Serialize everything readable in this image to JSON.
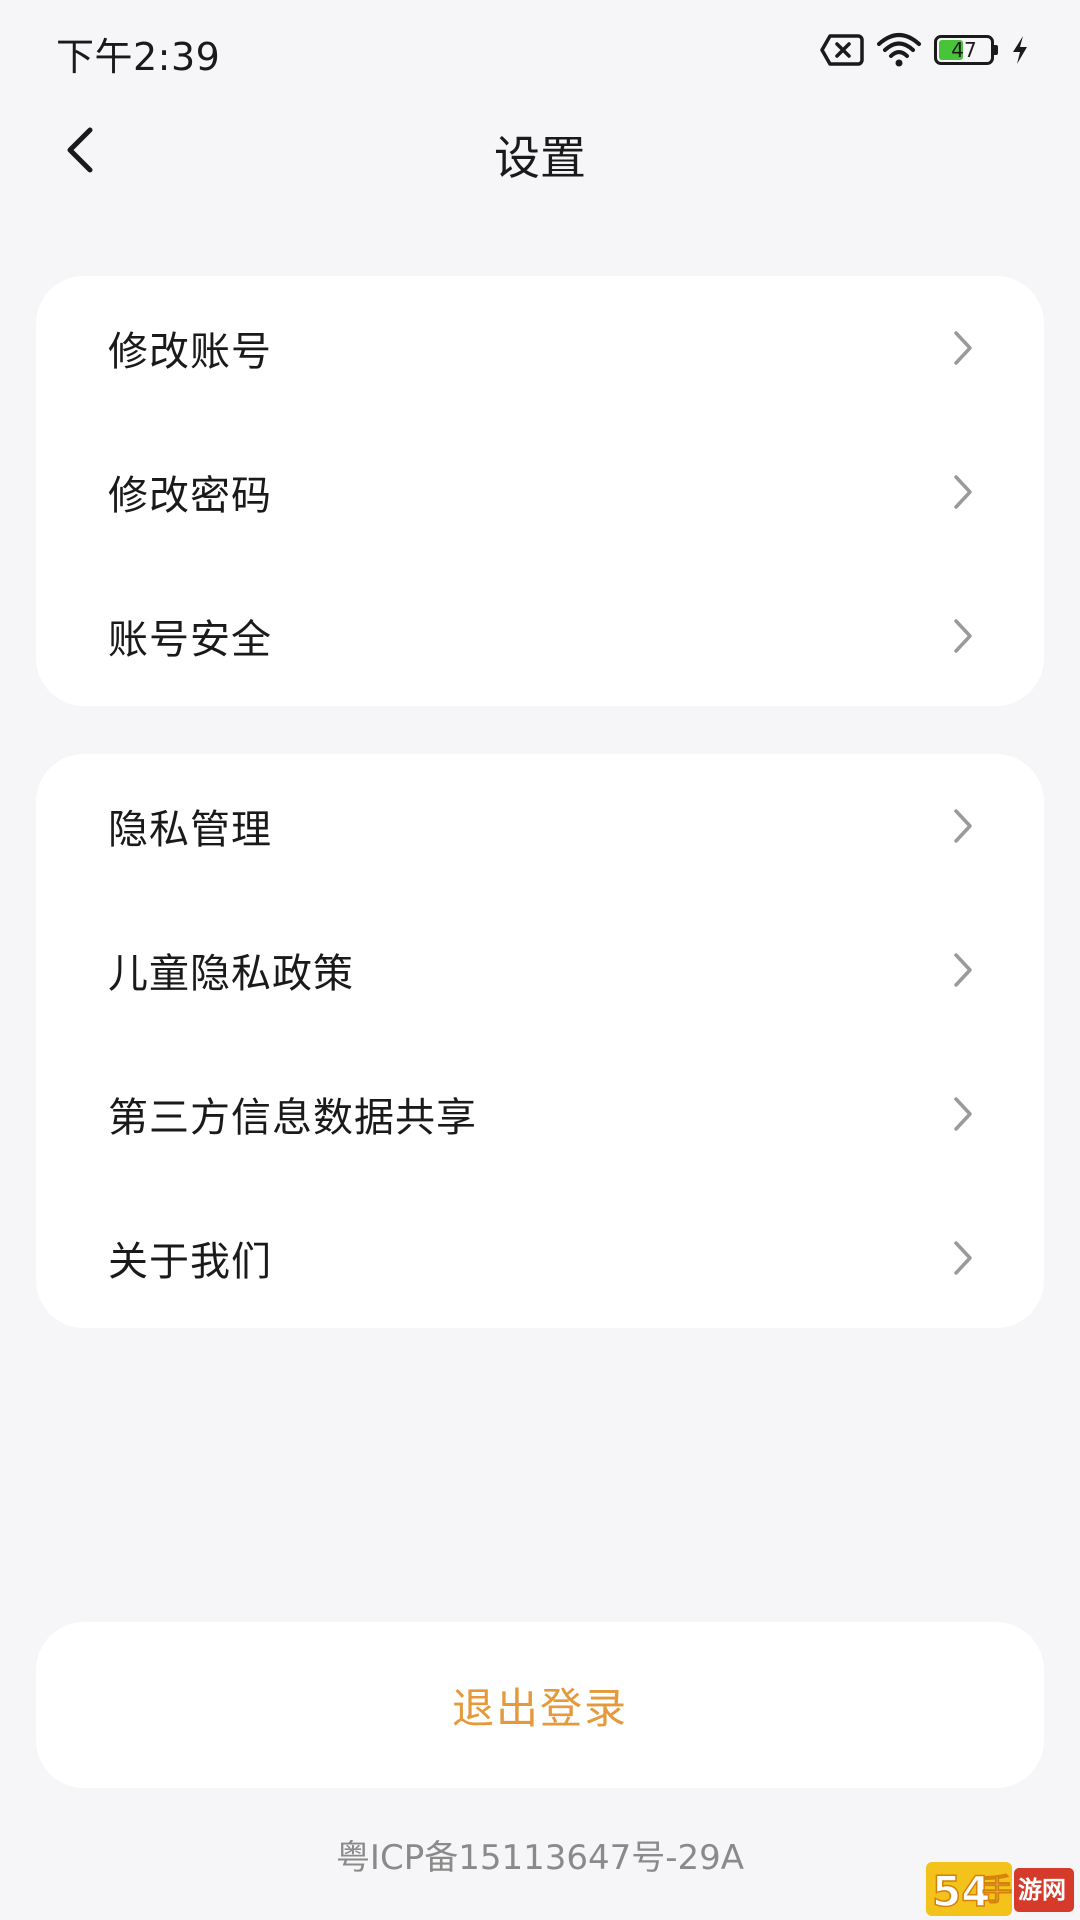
{
  "status_bar": {
    "time": "下午2:39",
    "battery_level": "47",
    "battery_fraction": 0.47,
    "battery_color": "#48c43a"
  },
  "nav": {
    "title": "设置"
  },
  "groups": [
    {
      "items": [
        {
          "label": "修改账号"
        },
        {
          "label": "修改密码"
        },
        {
          "label": "账号安全"
        }
      ]
    },
    {
      "items": [
        {
          "label": "隐私管理"
        },
        {
          "label": "儿童隐私政策"
        },
        {
          "label": "第三方信息数据共享"
        },
        {
          "label": "关于我们"
        }
      ]
    }
  ],
  "logout": {
    "label": "退出登录",
    "color": "#e49a3b"
  },
  "footer": {
    "icp": "粤ICP备15113647号-29A"
  },
  "watermark": {
    "text": "54手游网"
  }
}
